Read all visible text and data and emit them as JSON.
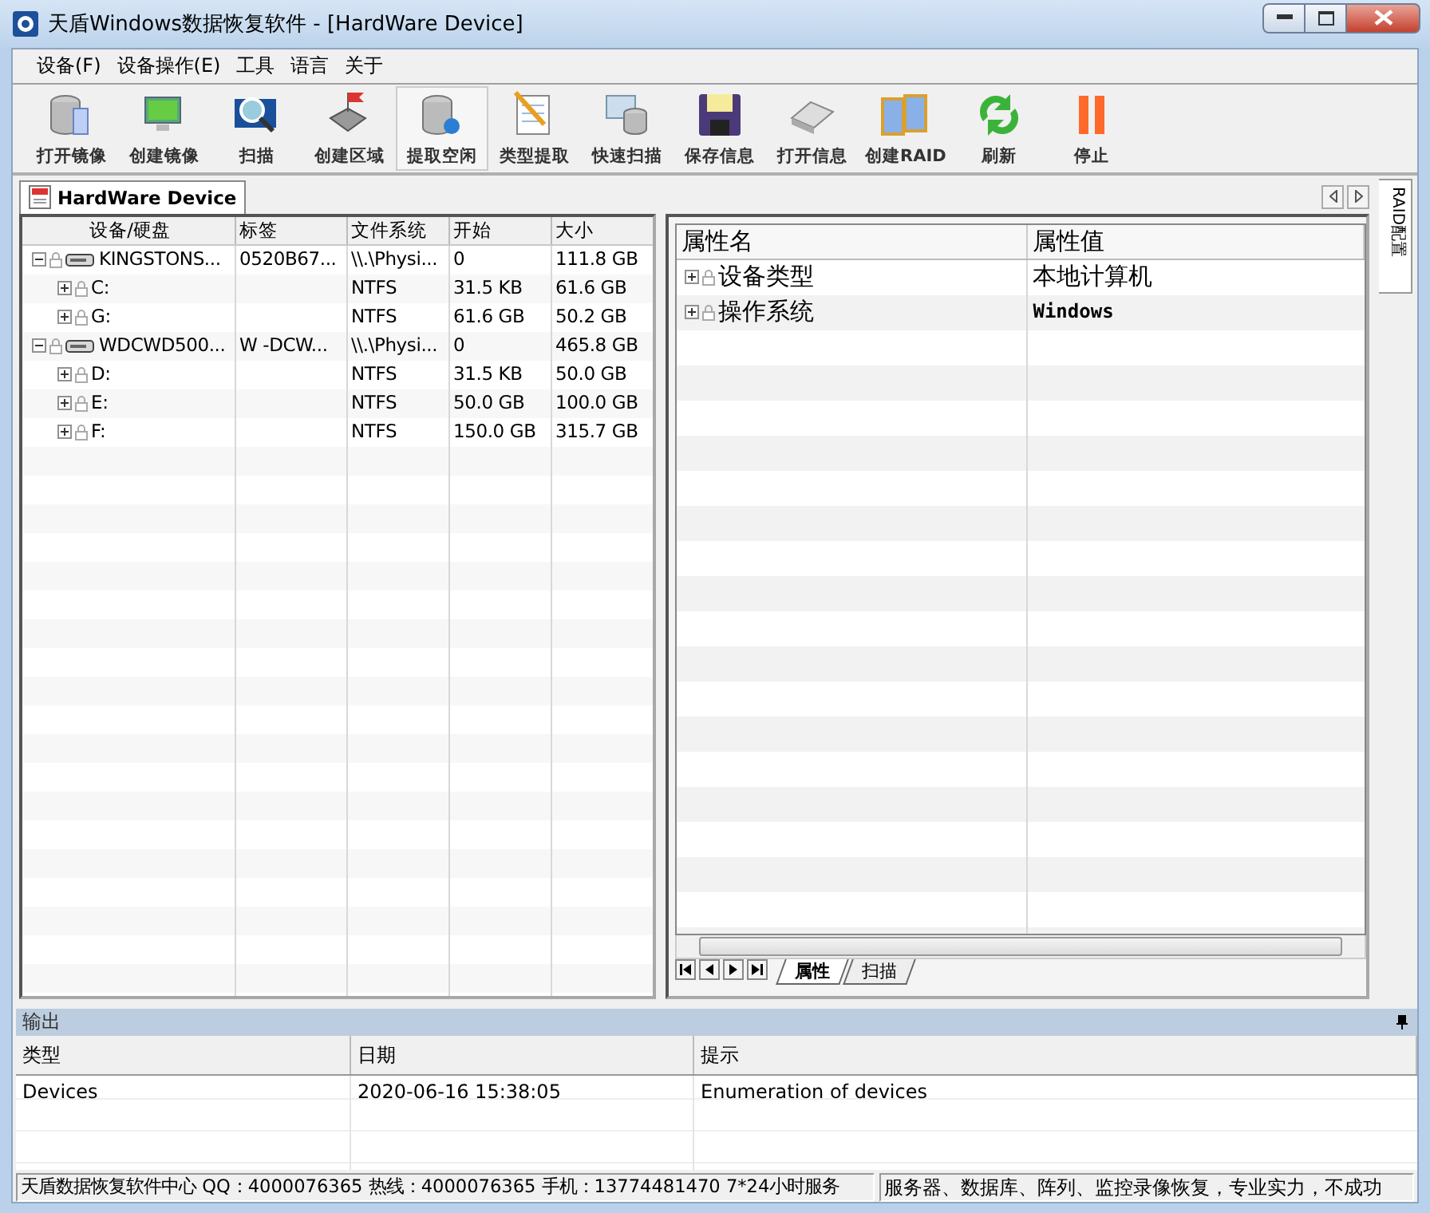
{
  "window": {
    "title": "天盾Windows数据恢复软件 - [HardWare Device]"
  },
  "menu": [
    "设备(F)",
    "设备操作(E)",
    "工具",
    "语言",
    "关于"
  ],
  "toolbar": [
    {
      "label": "打开镜像",
      "selected": false
    },
    {
      "label": "创建镜像",
      "selected": false
    },
    {
      "label": "扫描",
      "selected": false
    },
    {
      "label": "创建区域",
      "selected": false
    },
    {
      "label": "提取空闲",
      "selected": true
    },
    {
      "label": "类型提取",
      "selected": false
    },
    {
      "label": "快速扫描",
      "selected": false
    },
    {
      "label": "保存信息",
      "selected": false
    },
    {
      "label": "打开信息",
      "selected": false
    },
    {
      "label": "创建RAID",
      "selected": false
    },
    {
      "label": "刷新",
      "selected": false
    },
    {
      "label": "停止",
      "selected": false
    }
  ],
  "document_tab": "HardWare Device",
  "side_tab": "RAID配置",
  "device_table": {
    "columns": [
      "设备/硬盘",
      "标签",
      "文件系统",
      "开始",
      "大小"
    ],
    "rows": [
      {
        "name": "KINGSTONS...",
        "label": "0520B67...",
        "fs": "\\\\.\\Physi...",
        "start": "0",
        "size": "111.8 GB",
        "expanded": true,
        "children": [
          {
            "name": "C:",
            "fs": "NTFS",
            "start": "31.5 KB",
            "size": "61.6 GB",
            "expanded": false
          },
          {
            "name": "G:",
            "fs": "NTFS",
            "start": "61.6 GB",
            "size": "50.2 GB",
            "expanded": false
          }
        ]
      },
      {
        "name": "WDCWD500...",
        "label": "W -DCW...",
        "fs": "\\\\.\\Physi...",
        "start": "0",
        "size": "465.8 GB",
        "expanded": true,
        "children": [
          {
            "name": "D:",
            "fs": "NTFS",
            "start": "31.5 KB",
            "size": "50.0 GB",
            "expanded": false
          },
          {
            "name": "E:",
            "fs": "NTFS",
            "start": "50.0 GB",
            "size": "100.0 GB",
            "expanded": false
          },
          {
            "name": "F:",
            "fs": "NTFS",
            "start": "150.0 GB",
            "size": "315.7 GB",
            "expanded": false
          }
        ]
      }
    ]
  },
  "property_table": {
    "columns": [
      "属性名",
      "属性值"
    ],
    "rows": [
      {
        "name": "设备类型",
        "value": "本地计算机",
        "kind": "plain",
        "expanded": false
      },
      {
        "name": "操作系统",
        "value": "Windows",
        "kind": "code",
        "expanded": false
      }
    ]
  },
  "property_tabs": [
    {
      "label": "属性",
      "selected": true
    },
    {
      "label": "扫描",
      "selected": false
    }
  ],
  "output": {
    "title": "输出",
    "columns": [
      "类型",
      "日期",
      "提示"
    ],
    "rows": [
      [
        "Devices",
        "2020-06-16 15:38:05",
        "Enumeration of devices"
      ]
    ]
  },
  "status_bar": [
    "天盾数据恢复软件中心 QQ：4000076365 热线：4000076365 手机：13774481470   7*24小时服务",
    "服务器、数据库、阵列、监控录像恢复，专业实力，不成功"
  ]
}
